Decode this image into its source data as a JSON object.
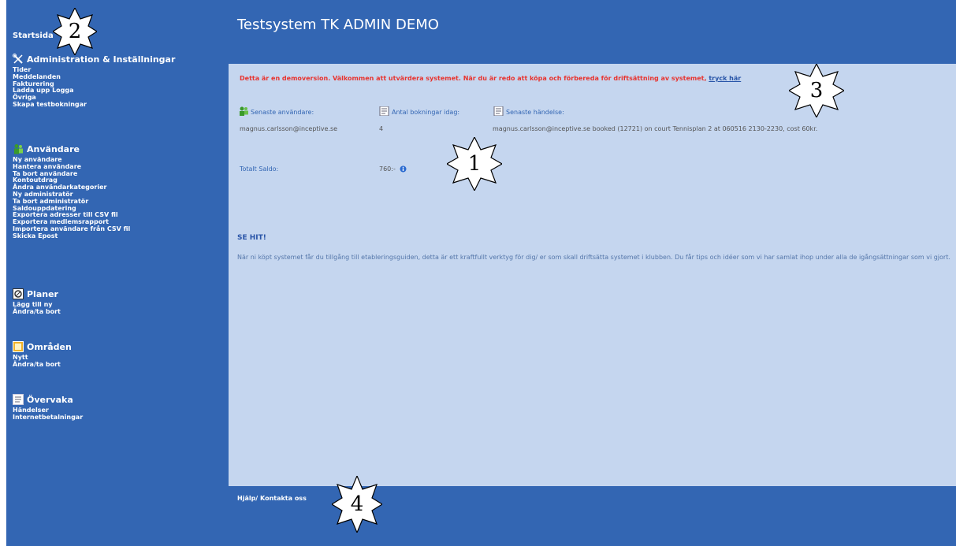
{
  "app": {
    "title": "Testsystem TK ADMIN DEMO"
  },
  "sidebar": {
    "home": "Startsida",
    "sections": [
      {
        "title": "Administration & Inställningar",
        "icon": "tools-icon",
        "items": [
          "Tider",
          "Meddelanden",
          "Fakturering",
          "Ladda upp Logga",
          "Övriga",
          "Skapa testbokningar"
        ]
      },
      {
        "title": "Användare",
        "icon": "users-icon",
        "items": [
          "Ny användare",
          "Hantera användare",
          "Ta bort användare",
          "Kontoutdrag",
          "Ändra användarkategorier",
          "Ny administratör",
          "Ta bort administratör",
          "Saldouppdatering",
          "Exportera adresser till CSV fil",
          "Exportera medlemsrapport",
          "Importera användare från CSV fil",
          "Skicka Epost"
        ]
      },
      {
        "title": "Planer",
        "icon": "court-icon",
        "items": [
          "Lägg till ny",
          "Ändra/ta bort"
        ]
      },
      {
        "title": "Områden",
        "icon": "area-icon",
        "items": [
          "Nytt",
          "Ändra/ta bort"
        ]
      },
      {
        "title": "Övervaka",
        "icon": "monitor-icon",
        "items": [
          "Händelser",
          "Internetbetalningar"
        ]
      }
    ]
  },
  "main": {
    "demo_notice": "Detta är en demoversion. Välkommen att utvärdera systemet. När du är redo att köpa och förbereda för driftsättning av systemet,",
    "demo_link": "tryck här",
    "latest_user_label": "Senaste användare:",
    "latest_user_value": "magnus.carlsson@inceptive.se",
    "bookings_today_label": "Antal bokningar idag:",
    "bookings_today_value": "4",
    "latest_event_label": "Senaste händelse:",
    "latest_event_value": "magnus.carlsson@inceptive.se booked (12721) on court Tennisplan 2 at 060516 2130-2230, cost 60kr.",
    "total_balance_label": "Totalt Saldo:",
    "total_balance_value": "760:-",
    "se_hit_heading": "SE HIT!",
    "se_hit_text": "När ni köpt systemet får du tillgång till etableringsguiden, detta är ett kraftfullt verktyg för dig/ er som skall driftsätta systemet i klubben. Du får tips och idéer som vi har samlat ihop under alla de igångsättningar som vi gjort."
  },
  "footer": {
    "help_link": "Hjälp/ Kontakta oss"
  },
  "callouts": [
    "1",
    "2",
    "3",
    "4"
  ],
  "colors": {
    "frame": "#3366b3",
    "panel": "#c5d6ef",
    "notice": "#e8332e",
    "label": "#3366b3"
  }
}
